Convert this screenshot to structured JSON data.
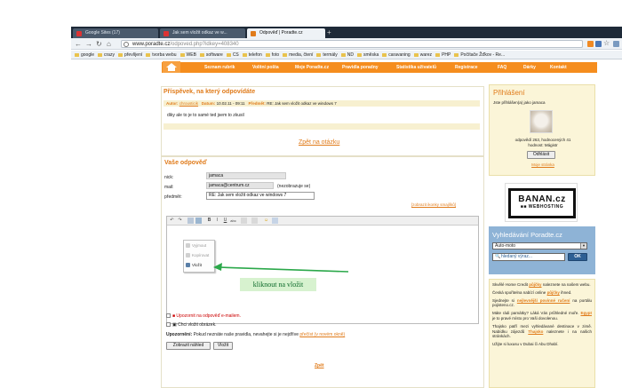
{
  "browser": {
    "tabs": [
      {
        "label": "Google Sites (17)"
      },
      {
        "label": "Jak sem vložit odkaz ve w..."
      },
      {
        "label": "Odpověď | Poradte.cz"
      }
    ],
    "url_domain": "www.poradte.cz",
    "url_path": "/odpoved.php?idkey=408340",
    "bookmarks": [
      "google",
      "crazy",
      "převlíjení",
      "tvorba webu",
      "WEB",
      "software",
      "CS",
      "telefon",
      "foto",
      "media, čtení",
      "termály",
      "ND",
      "směska",
      "caravaning",
      "warez",
      "PHP",
      "Počítače Žďkov - Re..."
    ]
  },
  "nav": {
    "items": [
      "Seznam rubrik",
      "Volitní pošta",
      "Moje Poradte.cz",
      "Pravidla poradny",
      "Statistika uživatelů",
      "Registrace",
      "FAQ",
      "Dárky",
      "Kontakt"
    ]
  },
  "reply_post": {
    "title": "Příspěvek, na který odpovídáte",
    "meta_author_label": "Autor:",
    "meta_author": "chrousticik",
    "meta_date_label": "Datum:",
    "meta_date": "10.02.11 - 09:11",
    "meta_subject_label": "Předmět:",
    "meta_subject": "RE: Jak sem vložit odkaz ve windows 7",
    "body": "diky ale to je to samé ted jsem to zkusil",
    "back_link": "Zpět na otázku"
  },
  "form": {
    "title": "Vaše odpověď",
    "nick_label": "nick:",
    "nick": "jamaca",
    "mail_label": "mail:",
    "mail": "jamaca@centrum.cz",
    "mail_note": "(nezobrazuje se)",
    "subject_label": "předmět:",
    "subject": "RE: Jak sem vložit odkaz ve windows 7",
    "show_smileys": "[zobrazit ikonky smajlíků]",
    "notify_label": "Upozornit na odpověď e-mailem.",
    "image_label": "Chci vložit obrázek.",
    "warning_label": "Upozornění:",
    "warning_text": "Pokud neznáte naše pravidla, nevahejte si je nejdříve",
    "warning_link": "přečíst (v novém okně)",
    "preview_button": "Zobrazit náhled",
    "insert_button": "Vložit",
    "back": "Zpět"
  },
  "context_menu": {
    "items": [
      "Vyjmout",
      "Kopírovat",
      "Vložit"
    ]
  },
  "annotation": {
    "text": "kliknout na vložit",
    "color": "#0c6a2a",
    "arrow_color": "#2ba84a"
  },
  "login": {
    "title": "Přihlášení",
    "logged_as": "Jste přihlášen(a) jako jamaca",
    "stats": "odpovědí 263, hodnocených 41",
    "rank": "hodnost: Mágistr",
    "logout_button": "Odhlásit",
    "my_page": "Moje stránka"
  },
  "ad": {
    "brand": "BANAN.cz",
    "sub": "WEBHOSTING"
  },
  "search": {
    "title": "Vyhledávání Poradte.cz",
    "category": "Auto-moto",
    "placeholder": "hledaný výraz...",
    "button": "OK"
  },
  "promo": [
    {
      "text": "Skvělé Home Credit",
      "link": "půjčky",
      "text2": "naleznete na našem webu."
    },
    {
      "text": "Česká spořitelna nabízí online",
      "link": "půjčky",
      "text2": "ihned."
    },
    {
      "text": "Sjednejte si",
      "link": "nejlevnější povinné ručení",
      "text2": "na portálu pojisteno.cz."
    },
    {
      "text": "Máte rádi památky? Láká Vás průhledné moře.",
      "link": "Egypt",
      "text2": "je to pravé místo pro Vaši dovolenou."
    },
    {
      "text": "Thajsko patří mezi vyhledávané destinace v zimě. Nabídku zájezdů",
      "link": "Thajsko",
      "text2": "naleznete i na našich stránkách."
    },
    {
      "text": "Užijte si luxusu v Dubai či Abu Dhabí.",
      "link": "",
      "text2": ""
    }
  ],
  "colors": {
    "accent": "#f58d1e",
    "title": "#e07b1a",
    "search_bg": "#8eb3d6"
  }
}
